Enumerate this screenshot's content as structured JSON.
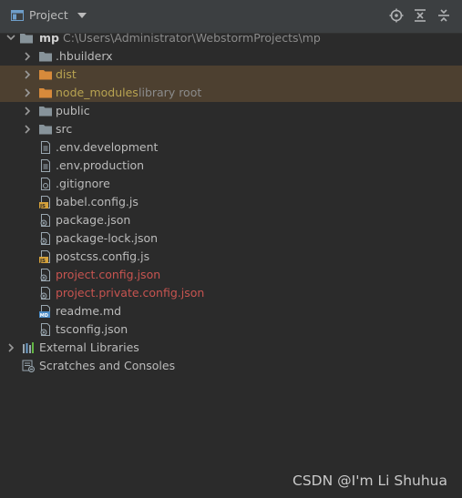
{
  "toolbar": {
    "title": "Project"
  },
  "tree": {
    "root": {
      "name": "mp",
      "path": "C:\\Users\\Administrator\\WebstormProjects\\mp"
    },
    "items": [
      {
        "label": ".hbuilderx"
      },
      {
        "label": "dist"
      },
      {
        "label": "node_modules",
        "suffix": "library root"
      },
      {
        "label": "public"
      },
      {
        "label": "src"
      },
      {
        "label": ".env.development"
      },
      {
        "label": ".env.production"
      },
      {
        "label": ".gitignore"
      },
      {
        "label": "babel.config.js"
      },
      {
        "label": "package.json"
      },
      {
        "label": "package-lock.json"
      },
      {
        "label": "postcss.config.js"
      },
      {
        "label": "project.config.json"
      },
      {
        "label": "project.private.config.json"
      },
      {
        "label": "readme.md"
      },
      {
        "label": "tsconfig.json"
      }
    ],
    "external_libraries": "External Libraries",
    "scratches": "Scratches and Consoles"
  },
  "watermark": "CSDN @I'm Li Shuhua",
  "colors": {
    "background": "#2b2b2b",
    "folder": "#87939a",
    "excluded_folder": "#d78a3b",
    "excluded_text": "#b8a351",
    "modified_text": "#c75450",
    "highlight": "#4d4030"
  }
}
